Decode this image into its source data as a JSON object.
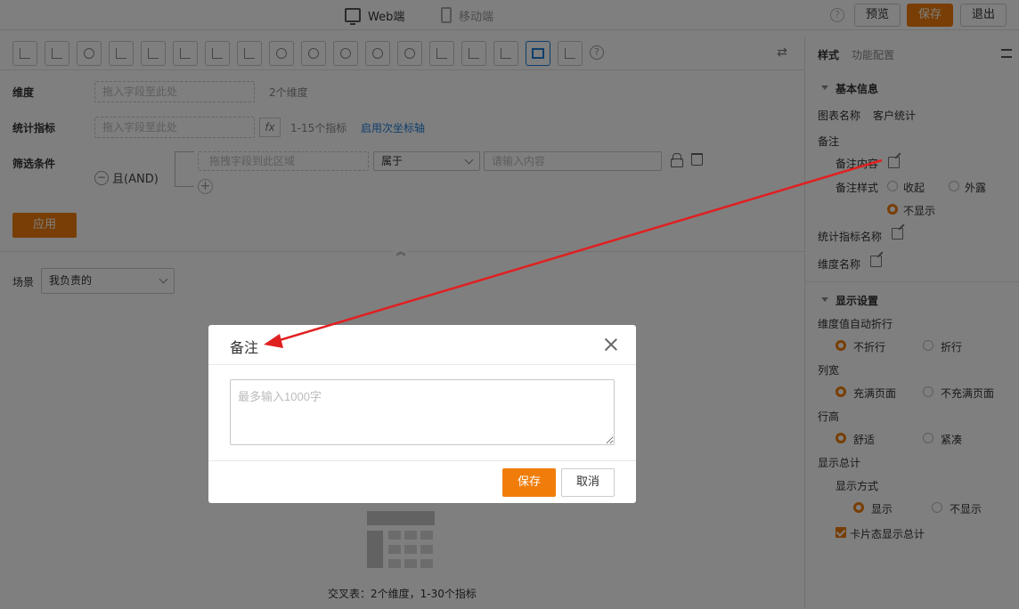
{
  "topbar": {
    "web_tab": "Web端",
    "mobile_tab": "移动端",
    "help": "?",
    "preview": "预览",
    "save": "保存",
    "exit": "退出"
  },
  "chart_toolbar": {
    "help": "?"
  },
  "config": {
    "dimension_label": "维度",
    "dimension_placeholder": "拖入字段至此处",
    "dimension_hint": "2个维度",
    "metric_label": "统计指标",
    "metric_placeholder": "拖入字段至此处",
    "fx": "fx",
    "metric_hint": "1-15个指标",
    "metric_link": "启用次坐标轴",
    "filter_label": "筛选条件",
    "and_label": "且(AND)",
    "filter_field_placeholder": "拖拽字段到此区域",
    "filter_operator": "属于",
    "filter_value_placeholder": "请输入内容",
    "apply": "应用",
    "scene_label": "场景",
    "scene_value": "我负责的"
  },
  "empty_state": {
    "caption": "交叉表：2个维度，1-30个指标"
  },
  "right_panel": {
    "tab_style": "样式",
    "tab_function": "功能配置",
    "basic_info": "基本信息",
    "chart_name_label": "图表名称",
    "chart_name_value": "客户统计",
    "note_label": "备注",
    "note_content_label": "备注内容",
    "note_style_label": "备注样式",
    "note_style_opt1": "收起",
    "note_style_opt2": "外露",
    "note_style_opt3": "不显示",
    "metric_name_label": "统计指标名称",
    "dimension_name_label": "维度名称",
    "display_settings": "显示设置",
    "wrap_label": "维度值自动折行",
    "wrap_opt1": "不折行",
    "wrap_opt2": "折行",
    "col_width_label": "列宽",
    "col_width_opt1": "充满页面",
    "col_width_opt2": "不充满页面",
    "row_height_label": "行高",
    "row_height_opt1": "舒适",
    "row_height_opt2": "紧凑",
    "total_label": "显示总计",
    "display_mode_label": "显示方式",
    "display_mode_opt1": "显示",
    "display_mode_opt2": "不显示",
    "card_total_label": "卡片态显示总计"
  },
  "modal": {
    "title": "备注",
    "textarea_placeholder": "最多输入1000字",
    "save": "保存",
    "cancel": "取消"
  },
  "colors": {
    "accent": "#f07d0a",
    "link": "#1e7fd8",
    "annotation_arrow": "#e02020"
  }
}
